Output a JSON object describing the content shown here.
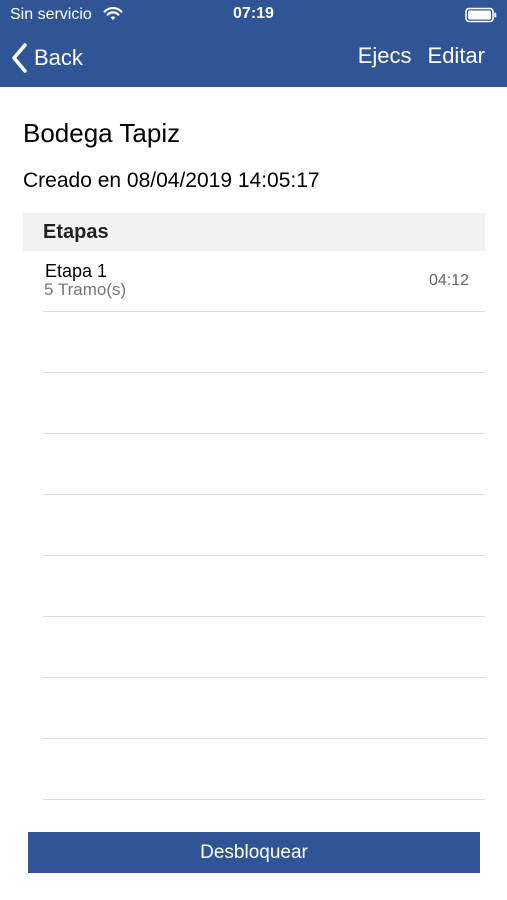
{
  "status_bar": {
    "carrier": "Sin servicio",
    "time": "07:19",
    "wifi_icon": "wifi-icon",
    "battery_icon": "battery-icon"
  },
  "nav": {
    "back_label": "Back",
    "back_icon": "chevron-left-icon",
    "actions": [
      "Ejecs",
      "Editar"
    ]
  },
  "content": {
    "title": "Bodega Tapiz",
    "created": "Creado en 08/04/2019 14:05:17",
    "section_header": "Etapas",
    "stages": [
      {
        "title": "Etapa 1",
        "subtitle": "5 Tramo(s)",
        "time": "04:12"
      }
    ]
  },
  "footer": {
    "button_label": "Desbloquear"
  },
  "colors": {
    "accent": "#2f5597",
    "section_bg": "#f2f2f2",
    "separator": "#dcdcdc"
  }
}
